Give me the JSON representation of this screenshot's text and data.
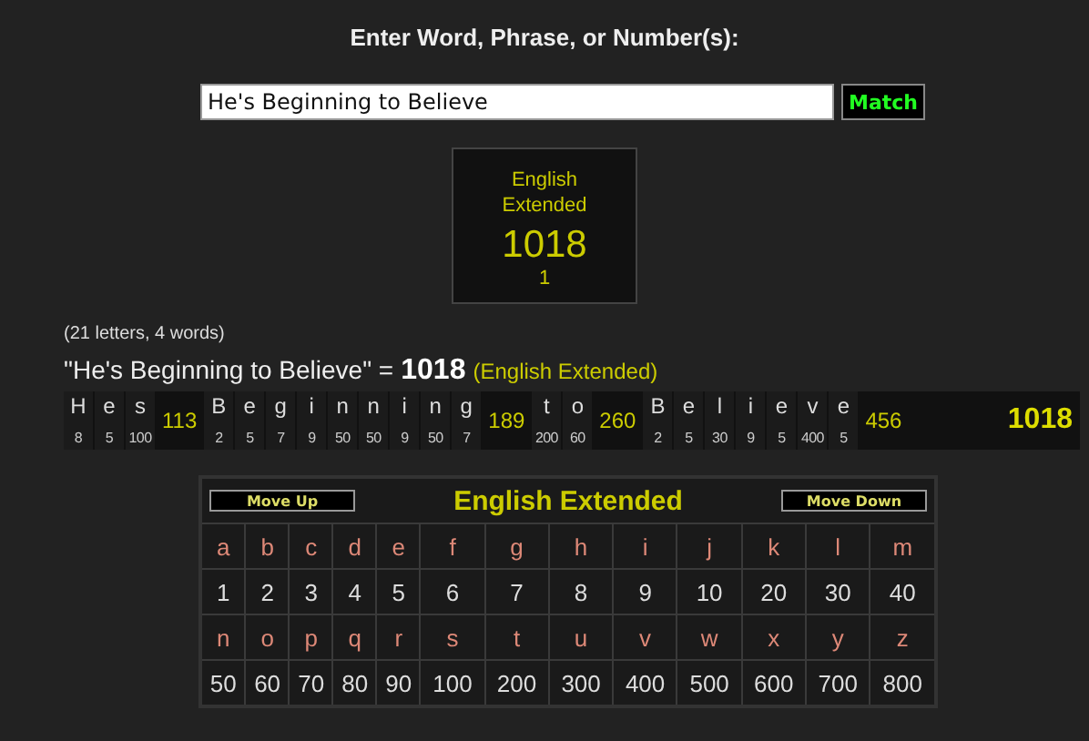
{
  "heading": "Enter Word, Phrase, or Number(s):",
  "search": {
    "value": "He's Beginning to Believe",
    "button": "Match"
  },
  "result_card": {
    "cipher": "English Extended",
    "value": "1018",
    "count": "1"
  },
  "stats": "(21 letters, 4 words)",
  "summary": {
    "phrase": "\"He's Beginning to Believe\" =",
    "value": "1018",
    "cipher": "(English Extended)"
  },
  "breakdown": [
    {
      "kind": "letter",
      "letter": "H",
      "value": "8"
    },
    {
      "kind": "letter",
      "letter": "e",
      "value": "5"
    },
    {
      "kind": "letter",
      "letter": "s",
      "value": "100"
    },
    {
      "kind": "word_total",
      "value": "113"
    },
    {
      "kind": "letter",
      "letter": "B",
      "value": "2"
    },
    {
      "kind": "letter",
      "letter": "e",
      "value": "5"
    },
    {
      "kind": "letter",
      "letter": "g",
      "value": "7"
    },
    {
      "kind": "letter",
      "letter": "i",
      "value": "9"
    },
    {
      "kind": "letter",
      "letter": "n",
      "value": "50"
    },
    {
      "kind": "letter",
      "letter": "n",
      "value": "50"
    },
    {
      "kind": "letter",
      "letter": "i",
      "value": "9"
    },
    {
      "kind": "letter",
      "letter": "n",
      "value": "50"
    },
    {
      "kind": "letter",
      "letter": "g",
      "value": "7"
    },
    {
      "kind": "word_total",
      "value": "189"
    },
    {
      "kind": "letter",
      "letter": "t",
      "value": "200"
    },
    {
      "kind": "letter",
      "letter": "o",
      "value": "60"
    },
    {
      "kind": "word_total",
      "value": "260"
    },
    {
      "kind": "letter",
      "letter": "B",
      "value": "2"
    },
    {
      "kind": "letter",
      "letter": "e",
      "value": "5"
    },
    {
      "kind": "letter",
      "letter": "l",
      "value": "30"
    },
    {
      "kind": "letter",
      "letter": "i",
      "value": "9"
    },
    {
      "kind": "letter",
      "letter": "e",
      "value": "5"
    },
    {
      "kind": "letter",
      "letter": "v",
      "value": "400"
    },
    {
      "kind": "letter",
      "letter": "e",
      "value": "5"
    },
    {
      "kind": "word_total",
      "value": "456"
    },
    {
      "kind": "grand_total",
      "value": "1018"
    }
  ],
  "cipher_table": {
    "title": "English Extended",
    "move_up": "Move Up",
    "move_down": "Move Down",
    "rows": [
      {
        "kind": "letters",
        "cells": [
          "a",
          "b",
          "c",
          "d",
          "e",
          "f",
          "g",
          "h",
          "i",
          "j",
          "k",
          "l",
          "m"
        ]
      },
      {
        "kind": "values",
        "cells": [
          "1",
          "2",
          "3",
          "4",
          "5",
          "6",
          "7",
          "8",
          "9",
          "10",
          "20",
          "30",
          "40"
        ]
      },
      {
        "kind": "letters",
        "cells": [
          "n",
          "o",
          "p",
          "q",
          "r",
          "s",
          "t",
          "u",
          "v",
          "w",
          "x",
          "y",
          "z"
        ]
      },
      {
        "kind": "values",
        "cells": [
          "50",
          "60",
          "70",
          "80",
          "90",
          "100",
          "200",
          "300",
          "400",
          "500",
          "600",
          "700",
          "800"
        ]
      }
    ]
  }
}
